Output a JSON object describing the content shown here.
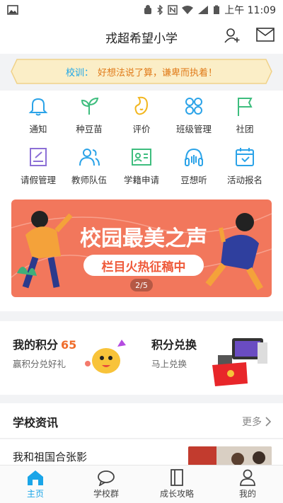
{
  "status_bar": {
    "time": "上午 11:09",
    "icons": [
      "image-icon",
      "android-icon",
      "bluetooth-icon",
      "nfc-icon",
      "wifi-icon",
      "signal-icon",
      "battery-icon"
    ]
  },
  "header": {
    "title": "戎超希望小学",
    "icons": [
      "add-user-icon",
      "mail-icon"
    ]
  },
  "motto": {
    "label": "校训：",
    "text": "好想法说了算，谦卑而执着！"
  },
  "menu": [
    {
      "label": "通知",
      "icon": "bell-icon"
    },
    {
      "label": "种豆苗",
      "icon": "sprout-icon"
    },
    {
      "label": "评价",
      "icon": "bean-icon"
    },
    {
      "label": "班级管理",
      "icon": "grid-icon"
    },
    {
      "label": "社团",
      "icon": "flag-icon"
    },
    {
      "label": "请假管理",
      "icon": "form-icon"
    },
    {
      "label": "教师队伍",
      "icon": "users-icon"
    },
    {
      "label": "学籍申请",
      "icon": "id-card-icon"
    },
    {
      "label": "豆想听",
      "icon": "headphones-icon"
    },
    {
      "label": "活动报名",
      "icon": "calendar-icon"
    }
  ],
  "carousel": {
    "headline": "校园最美之声",
    "subline": "栏目火热征稿中",
    "page": "2/5"
  },
  "points": {
    "mine_title": "我的积分",
    "mine_value": "65",
    "mine_sub": "赢积分兑好礼",
    "exchange_title": "积分兑换",
    "exchange_sub": "马上兑换"
  },
  "news": {
    "title": "学校资讯",
    "more": "更多",
    "items": [
      {
        "title": "我和祖国合张影"
      }
    ]
  },
  "tabbar": [
    {
      "label": "主页",
      "icon": "home-icon",
      "active": true
    },
    {
      "label": "学校群",
      "icon": "chat-icon",
      "active": false
    },
    {
      "label": "成长攻略",
      "icon": "book-icon",
      "active": false
    },
    {
      "label": "我的",
      "icon": "profile-icon",
      "active": false
    }
  ],
  "colors": {
    "accent": "#1aa5e8",
    "orange": "#ef6c2b",
    "motto_bg": "#fbeec7",
    "carousel_bg": "#f2775c"
  }
}
